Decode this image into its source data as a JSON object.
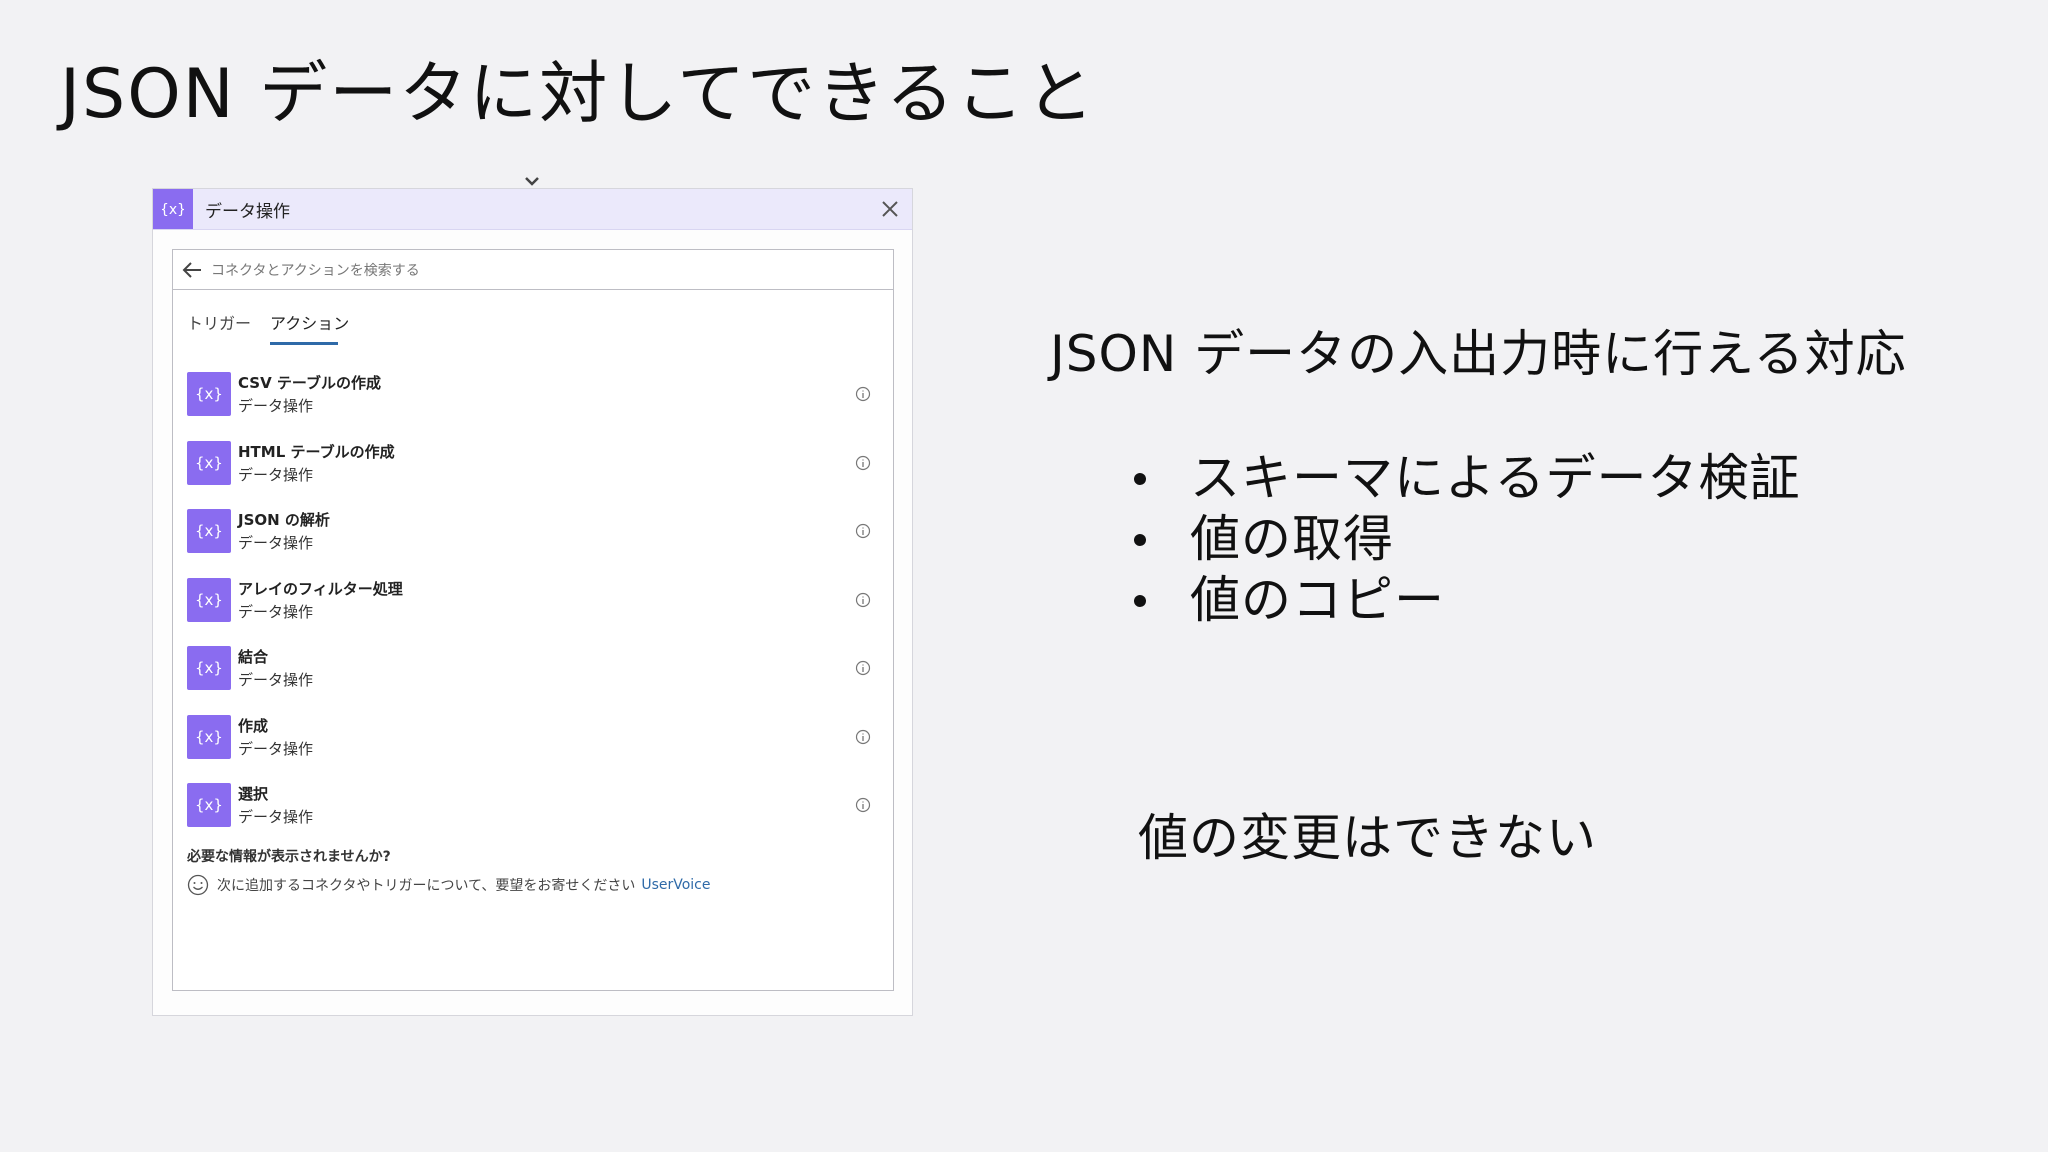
{
  "slide": {
    "title": "JSON データに対してできること",
    "right_heading": "JSON データの入出力時に行える対応",
    "bullets": [
      "スキーマによるデータ検証",
      "値の取得",
      "値のコピー"
    ],
    "note": "値の変更はできない"
  },
  "panel": {
    "title": "データ操作",
    "search_placeholder": "コネクタとアクションを検索する",
    "tabs": [
      "トリガー",
      "アクション"
    ],
    "active_tab": "アクション",
    "actions": [
      {
        "name": "CSV テーブルの作成",
        "connector": "データ操作",
        "icon": "variable-icon"
      },
      {
        "name": "HTML テーブルの作成",
        "connector": "データ操作",
        "icon": "variable-icon"
      },
      {
        "name": "JSON の解析",
        "connector": "データ操作",
        "icon": "variable-icon"
      },
      {
        "name": "アレイのフィルター処理",
        "connector": "データ操作",
        "icon": "variable-icon"
      },
      {
        "name": "結合",
        "connector": "データ操作",
        "icon": "variable-icon"
      },
      {
        "name": "作成",
        "connector": "データ操作",
        "icon": "variable-icon"
      },
      {
        "name": "選択",
        "connector": "データ操作",
        "icon": "variable-icon"
      }
    ],
    "help_question": "必要な情報が表示されませんか?",
    "help_text": "次に追加するコネクタやトリガーについて、要望をお寄せください",
    "help_link": "UserVoice"
  },
  "colors": {
    "accent_purple": "#8a6cf0",
    "header_bg": "#ebe9fb",
    "link_blue": "#2f6aa8",
    "background": "#f2f2f4"
  }
}
